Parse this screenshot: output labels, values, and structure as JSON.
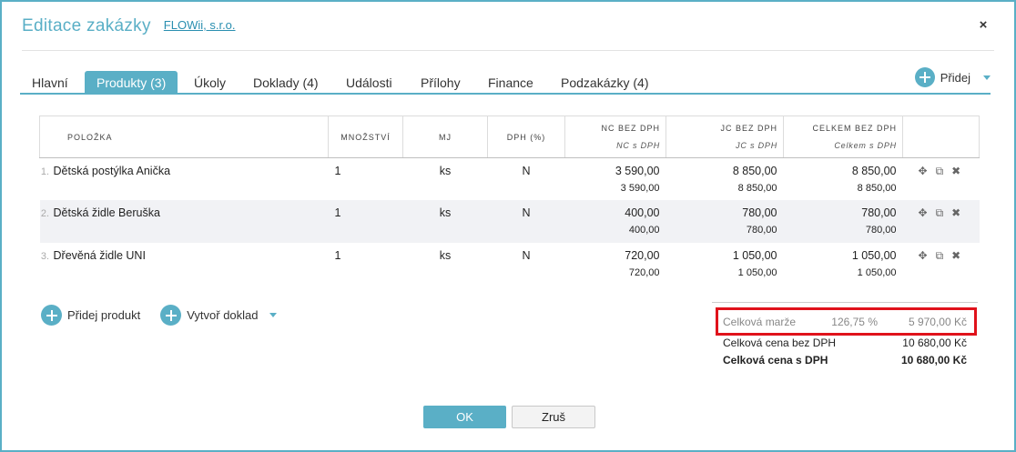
{
  "dialog": {
    "title": "Editace zakázky",
    "client_link": "FLOWii, s.r.o.",
    "close_icon": "×"
  },
  "tabs": [
    {
      "label": "Hlavní"
    },
    {
      "label": "Produkty (3)",
      "active": true
    },
    {
      "label": "Úkoly"
    },
    {
      "label": "Doklady (4)"
    },
    {
      "label": "Události"
    },
    {
      "label": "Přílohy"
    },
    {
      "label": "Finance"
    },
    {
      "label": "Podzakázky (4)"
    }
  ],
  "add_menu": {
    "label": "Přidej",
    "icon": "plus-circle-icon"
  },
  "table": {
    "headers": {
      "item": "POLOŽKA",
      "qty": "MNOŽSTVÍ",
      "unit": "MJ",
      "vat": "DPH (%)",
      "nc": "NC BEZ DPH",
      "nc_sub": "NC s DPH",
      "jc": "JC BEZ DPH",
      "jc_sub": "JC s DPH",
      "total": "CELKEM BEZ DPH",
      "total_sub": "Celkem s DPH"
    },
    "rows": [
      {
        "num": "1.",
        "name": "Dětská postýlka Anička",
        "qty": "1",
        "unit": "ks",
        "vat": "N",
        "nc": "3 590,00",
        "nc_vat": "3 590,00",
        "jc": "8 850,00",
        "jc_vat": "8 850,00",
        "total": "8 850,00",
        "total_vat": "8 850,00"
      },
      {
        "num": "2.",
        "name": "Dětská židle Beruška",
        "qty": "1",
        "unit": "ks",
        "vat": "N",
        "nc": "400,00",
        "nc_vat": "400,00",
        "jc": "780,00",
        "jc_vat": "780,00",
        "total": "780,00",
        "total_vat": "780,00"
      },
      {
        "num": "3.",
        "name": "Dřevěná židle UNI",
        "qty": "1",
        "unit": "ks",
        "vat": "N",
        "nc": "720,00",
        "nc_vat": "720,00",
        "jc": "1 050,00",
        "jc_vat": "1 050,00",
        "total": "1 050,00",
        "total_vat": "1 050,00"
      }
    ],
    "row_action_icons": [
      "move-icon",
      "copy-icon",
      "delete-icon"
    ]
  },
  "bottom_actions": {
    "add_product": "Přidej produkt",
    "create_document": "Vytvoř doklad"
  },
  "totals": {
    "margin_label": "Celková marže",
    "margin_pct": "126,75 %",
    "margin_amount": "5 970,00 Kč",
    "net_label": "Celková cena bez DPH",
    "net_amount": "10 680,00 Kč",
    "gross_label": "Celková cena s DPH",
    "gross_amount": "10 680,00 Kč",
    "highlight_color": "#e0121b"
  },
  "buttons": {
    "ok": "OK",
    "cancel": "Zruš"
  },
  "colors": {
    "accent": "#5aafc6",
    "highlight": "#e0121b"
  }
}
